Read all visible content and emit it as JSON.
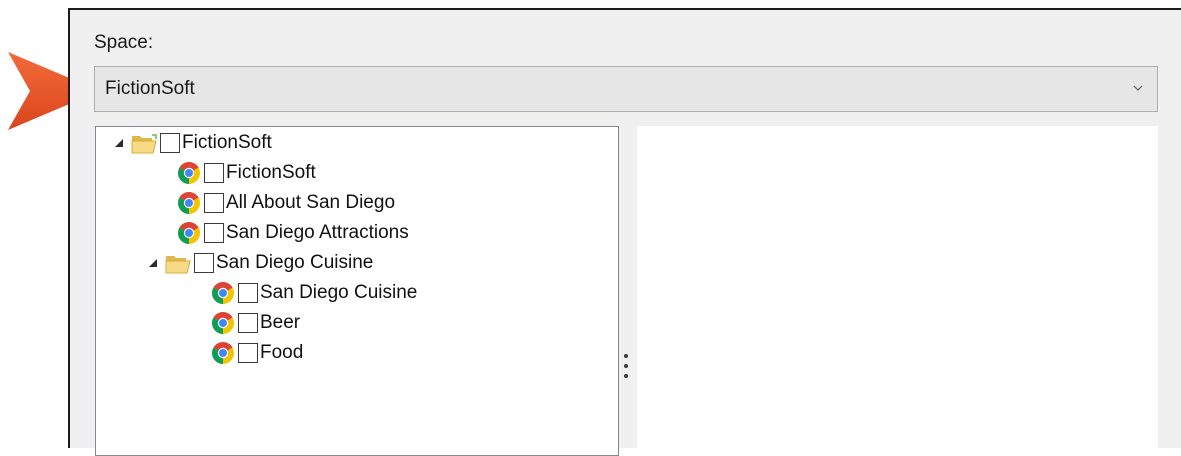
{
  "space": {
    "label": "Space:",
    "selected": "FictionSoft"
  },
  "tree": {
    "nodes": [
      {
        "label": "FictionSoft",
        "type": "folder",
        "level": 0,
        "expanded": true,
        "checked": false
      },
      {
        "label": "FictionSoft",
        "type": "page",
        "level": 1,
        "checked": false
      },
      {
        "label": "All About San Diego",
        "type": "page",
        "level": 1,
        "checked": false
      },
      {
        "label": "San Diego Attractions",
        "type": "page",
        "level": 1,
        "checked": false
      },
      {
        "label": "San Diego Cuisine",
        "type": "folder",
        "level": 1,
        "expanded": true,
        "checked": false
      },
      {
        "label": "San Diego Cuisine",
        "type": "page",
        "level": 2,
        "checked": false
      },
      {
        "label": "Beer",
        "type": "page",
        "level": 2,
        "checked": false
      },
      {
        "label": "Food",
        "type": "page",
        "level": 2,
        "checked": false
      }
    ]
  },
  "icons": {
    "pointer": "pointer-arrow-icon",
    "dropdown": "chevron-down-icon",
    "folder": "folder-open-icon",
    "page": "chrome-icon",
    "splitter": "splitter-grip-icon"
  },
  "colors": {
    "arrow": "#e8562a",
    "panel": "#f0f0f0",
    "folder": "#f1d27a"
  }
}
